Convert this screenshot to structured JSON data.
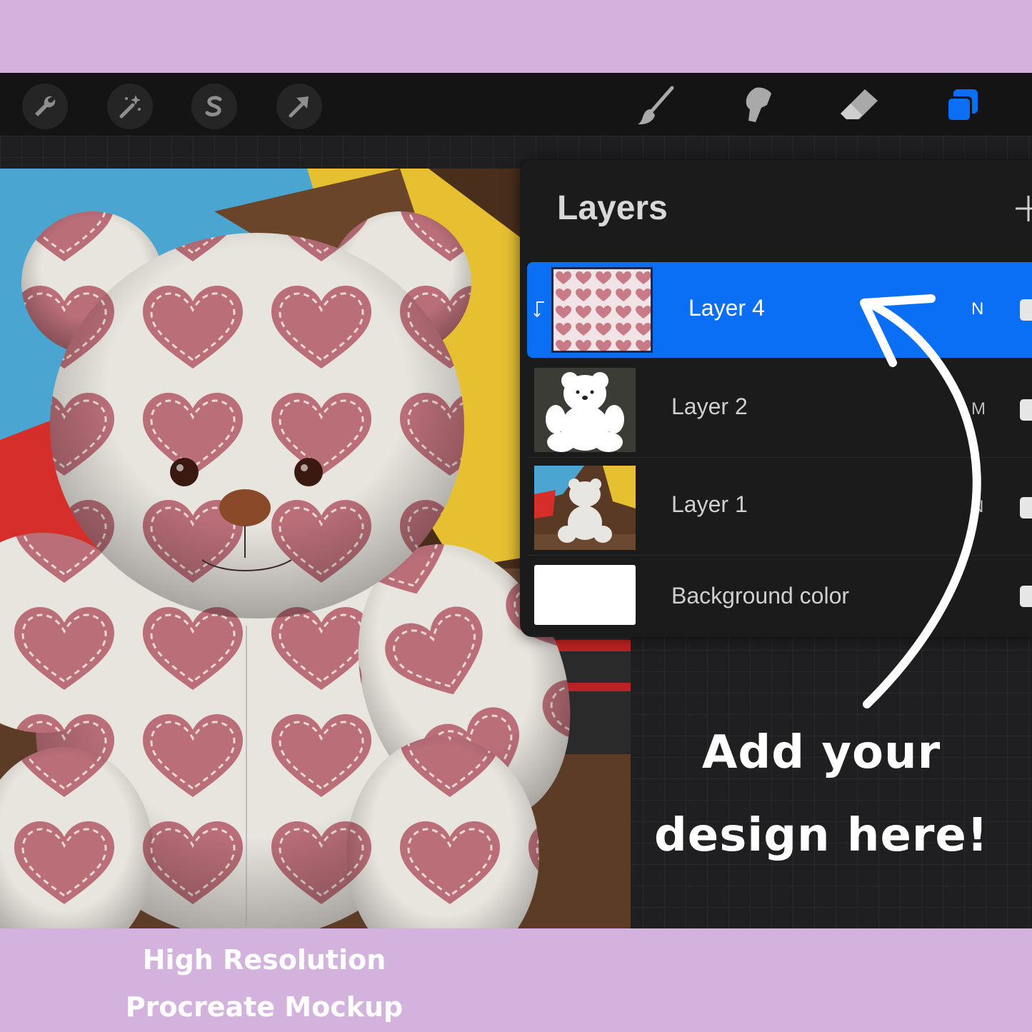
{
  "toolbar": {
    "left_tools": [
      {
        "name": "wrench-icon",
        "label": "Actions"
      },
      {
        "name": "magic-wand-icon",
        "label": "Adjustments"
      },
      {
        "name": "selection-icon",
        "label": "Selection"
      },
      {
        "name": "arrow-icon",
        "label": "Transform"
      }
    ],
    "right_tools": [
      {
        "name": "brush-icon",
        "label": "Paint"
      },
      {
        "name": "smudge-icon",
        "label": "Smudge"
      },
      {
        "name": "eraser-icon",
        "label": "Erase"
      },
      {
        "name": "layers-icon",
        "label": "Layers"
      }
    ],
    "active_color": "#0a6ff5"
  },
  "layers_panel": {
    "title": "Layers",
    "add_icon": "plus-icon",
    "layers": [
      {
        "name": "Layer 4",
        "blend": "N",
        "selected": true,
        "clipped": true,
        "visible": true
      },
      {
        "name": "Layer 2",
        "blend": "M",
        "selected": false,
        "clipped": false,
        "visible": true
      },
      {
        "name": "Layer 1",
        "blend": "N",
        "selected": false,
        "clipped": false,
        "visible": true
      },
      {
        "name": "Background color",
        "blend": "",
        "selected": false,
        "clipped": false,
        "visible": true
      }
    ]
  },
  "callout": {
    "line1": "Add your",
    "line2": "design here!"
  },
  "footer": {
    "line1": "High Resolution",
    "line2": "Procreate Mockup"
  },
  "colors": {
    "frame": "#d3b3de",
    "heart": "#b96e78",
    "fabric": "#e8e4de",
    "selection": "#0a6ff5"
  }
}
